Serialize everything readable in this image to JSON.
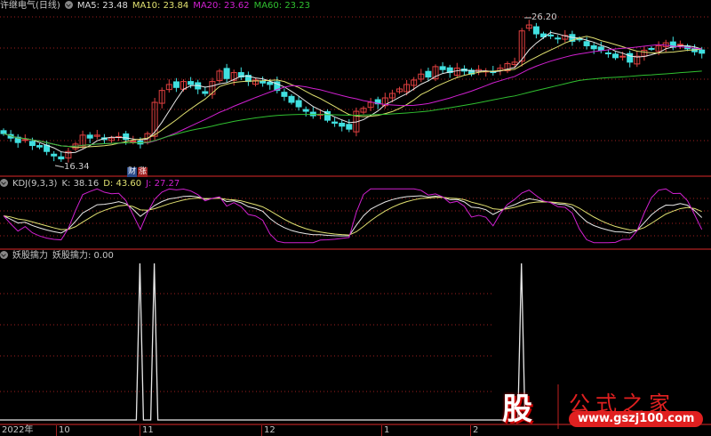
{
  "header": {
    "title": "许继电气(日线)",
    "ma5": "MA5: 23.48",
    "ma10": "MA10: 23.84",
    "ma20": "MA20: 23.62",
    "ma60": "MA60: 23.23"
  },
  "kdj": {
    "name": "KDJ(9,3,3)",
    "k": "K: 38.16",
    "d": "D: 43.60",
    "j": "J: 27.27"
  },
  "indicator": {
    "name": "妖股擒力",
    "value": "妖股擒力: 0.00",
    "spike_indices": [
      19,
      21,
      72
    ]
  },
  "price_labels": {
    "high": "26.20",
    "low": "16.34"
  },
  "tags": {
    "cai": "财",
    "zhang": "涨"
  },
  "axis_labels": [
    "2022年",
    "10",
    "11",
    "12",
    "1",
    "2"
  ],
  "logo": {
    "char": "股",
    "name": "公式之家",
    "url": "www.gszj100.com"
  },
  "colors": {
    "up": "#e04040",
    "down": "#40e0e0",
    "ma5": "#e8e8e8",
    "ma10": "#e0e070",
    "ma20": "#d020d0",
    "ma60": "#30c030",
    "grid": "#a02020"
  },
  "closes": [
    18.3,
    18.0,
    17.7,
    17.9,
    17.5,
    17.4,
    17.1,
    16.8,
    16.6,
    17.1,
    17.6,
    18.2,
    18.0,
    18.2,
    17.9,
    18.0,
    18.1,
    17.9,
    17.8,
    17.6,
    18.3,
    20.4,
    21.2,
    21.6,
    21.4,
    21.8,
    21.6,
    21.3,
    21.0,
    21.8,
    22.5,
    22.0,
    22.4,
    22.1,
    21.8,
    21.9,
    21.7,
    21.6,
    21.2,
    20.8,
    20.4,
    20.1,
    19.8,
    19.5,
    19.6,
    19.2,
    19.0,
    18.8,
    18.6,
    19.8,
    20.0,
    20.4,
    20.3,
    20.7,
    21.0,
    21.3,
    21.6,
    21.9,
    22.3,
    22.1,
    22.8,
    22.6,
    22.4,
    22.7,
    22.5,
    22.3,
    22.6,
    22.5,
    22.4,
    22.7,
    23.0,
    23.1,
    25.2,
    25.6,
    25.0,
    24.8,
    24.9,
    24.7,
    24.9,
    24.5,
    24.6,
    24.2,
    24.0,
    23.9,
    23.7,
    23.4,
    23.5,
    23.1,
    23.5,
    23.9,
    24.0,
    24.2,
    24.4,
    24.1,
    24.3,
    24.0,
    23.8,
    23.7
  ]
}
